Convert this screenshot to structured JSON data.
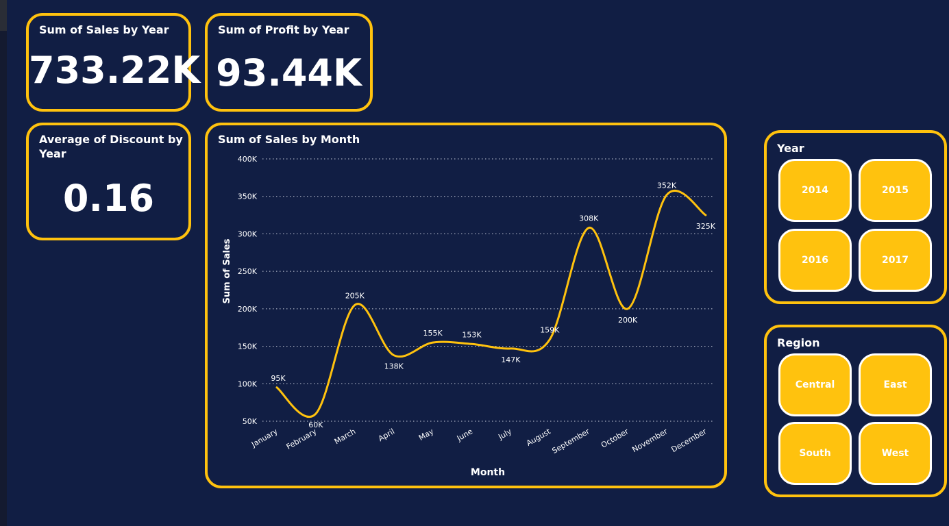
{
  "cards": {
    "sales": {
      "title": "Sum of Sales by Year",
      "value": "733.22K"
    },
    "profit": {
      "title": "Sum of Profit by Year",
      "value": "93.44K"
    },
    "discount": {
      "title_line1": "Average of Discount by",
      "title_line2": "Year",
      "value": "0.16"
    }
  },
  "chart_card": {
    "title": "Sum of Sales by Month"
  },
  "year_slicer": {
    "title": "Year",
    "options": [
      "2014",
      "2015",
      "2016",
      "2017"
    ]
  },
  "region_slicer": {
    "title": "Region",
    "options": [
      "Central",
      "East",
      "South",
      "West"
    ]
  },
  "colors": {
    "background": "#111e44",
    "accent": "#ffc20e",
    "text": "#ffffff"
  },
  "chart_data": {
    "type": "line",
    "title": "Sum of Sales by Month",
    "xlabel": "Month",
    "ylabel": "Sum of Sales",
    "categories": [
      "January",
      "February",
      "March",
      "April",
      "May",
      "June",
      "July",
      "August",
      "September",
      "October",
      "November",
      "December"
    ],
    "values": [
      95000,
      60000,
      205000,
      138000,
      155000,
      153000,
      147000,
      159000,
      308000,
      200000,
      352000,
      325000
    ],
    "data_labels": [
      "95K",
      "60K",
      "205K",
      "138K",
      "155K",
      "153K",
      "147K",
      "159K",
      "308K",
      "200K",
      "352K",
      "325K"
    ],
    "yticks": [
      50000,
      100000,
      150000,
      200000,
      250000,
      300000,
      350000,
      400000
    ],
    "ytick_labels": [
      "50K",
      "100K",
      "150K",
      "200K",
      "250K",
      "300K",
      "350K",
      "400K"
    ],
    "ylim": [
      50000,
      400000
    ],
    "grid": true,
    "legend": "none"
  }
}
